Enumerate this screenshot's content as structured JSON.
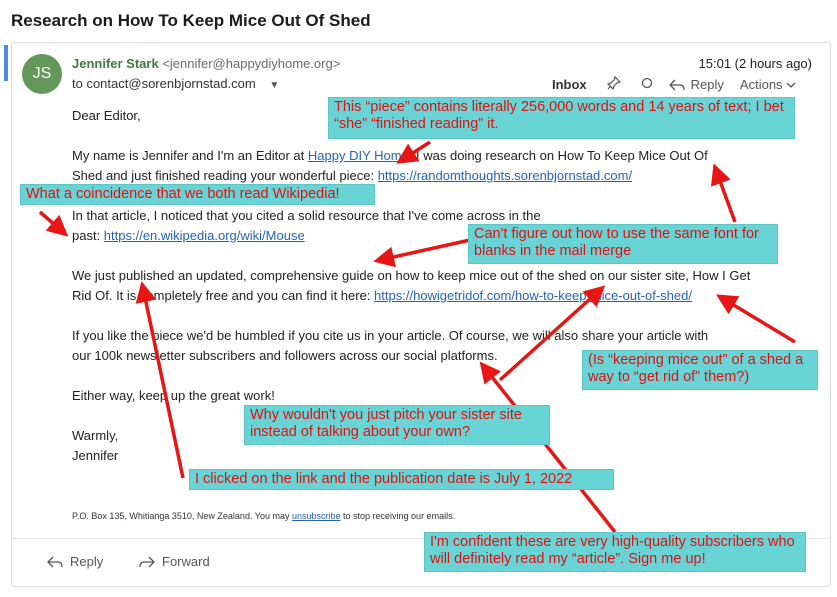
{
  "subject": "Research on How To Keep Mice Out Of Shed",
  "sender": {
    "initials": "JS",
    "name": "Jennifer Stark",
    "email": "<jennifer@happydiyhome.org>",
    "to": "to contact@sorenbjornstad.com",
    "time": "15:01 (2 hours ago)"
  },
  "toolbar": {
    "inbox": "Inbox",
    "reply": "Reply",
    "actions": "Actions"
  },
  "body": {
    "greeting": "Dear Editor,",
    "p1_a": "My name is Jennifer and I'm an Editor at ",
    "p1_link": "Happy DIY Home",
    "p1_b": ". I was doing research on How To Keep Mice Out Of",
    "p1_c": "Shed and just finished reading your wonderful piece: ",
    "p1_link2": "https://randomthoughts.sorenbjornstad.com/",
    "p2_a": "In that article, I noticed that you cited a solid resource that I've come across in the",
    "p2_b": "past: ",
    "p2_link": "https://en.wikipedia.org/wiki/Mouse",
    "p3_a": "We just published an updated, comprehensive guide on how to keep mice out of the shed on our sister site, How I Get",
    "p3_b": "Rid Of. It is completely free and you can find it here: ",
    "p3_link": "https://howigetridof.com/how-to-keep-mice-out-of-shed/",
    "p4_a": "If you like the piece we'd be humbled if you cite us in your article. Of course, we will also share your article with",
    "p4_b": "our 100k newsletter subscribers and followers across our social platforms.",
    "p5": "Either way, keep up the great work!",
    "signoff": "Warmly,",
    "signature": "Jennifer",
    "footer_a": "P.O. Box 135, Whitianga 3510, New Zealand. You may ",
    "footer_link": "unsubscribe",
    "footer_b": " to stop receiving our emails."
  },
  "footer_actions": {
    "reply": "Reply",
    "forward": "Forward"
  },
  "annotations": {
    "a1": "This “piece” contains literally 256,000 words and 14 years of text; I bet “she” “finished reading” it.",
    "a2": "What a coincidence that we both read Wikipedia!",
    "a3": "Can't figure out how to use the same font for blanks in the mail merge",
    "a4": "(Is “keeping mice out” of a shed a way to “get rid of” them?)",
    "a5": "Why wouldn't you just pitch your sister site instead of talking about your own?",
    "a6": "I clicked on the link and the publication date is July 1, 2022",
    "a7": "I'm confident these are very high-quality subscribers who will definitely read my “article”. Sign me up!"
  },
  "colors": {
    "accent": "#4a8fd8",
    "avatar": "#64975a",
    "sender_name": "#3f7a3f",
    "link": "#2563b8",
    "callout_bg": "#68d4d6",
    "callout_text": "#e11010",
    "arrow": "#e81515"
  }
}
